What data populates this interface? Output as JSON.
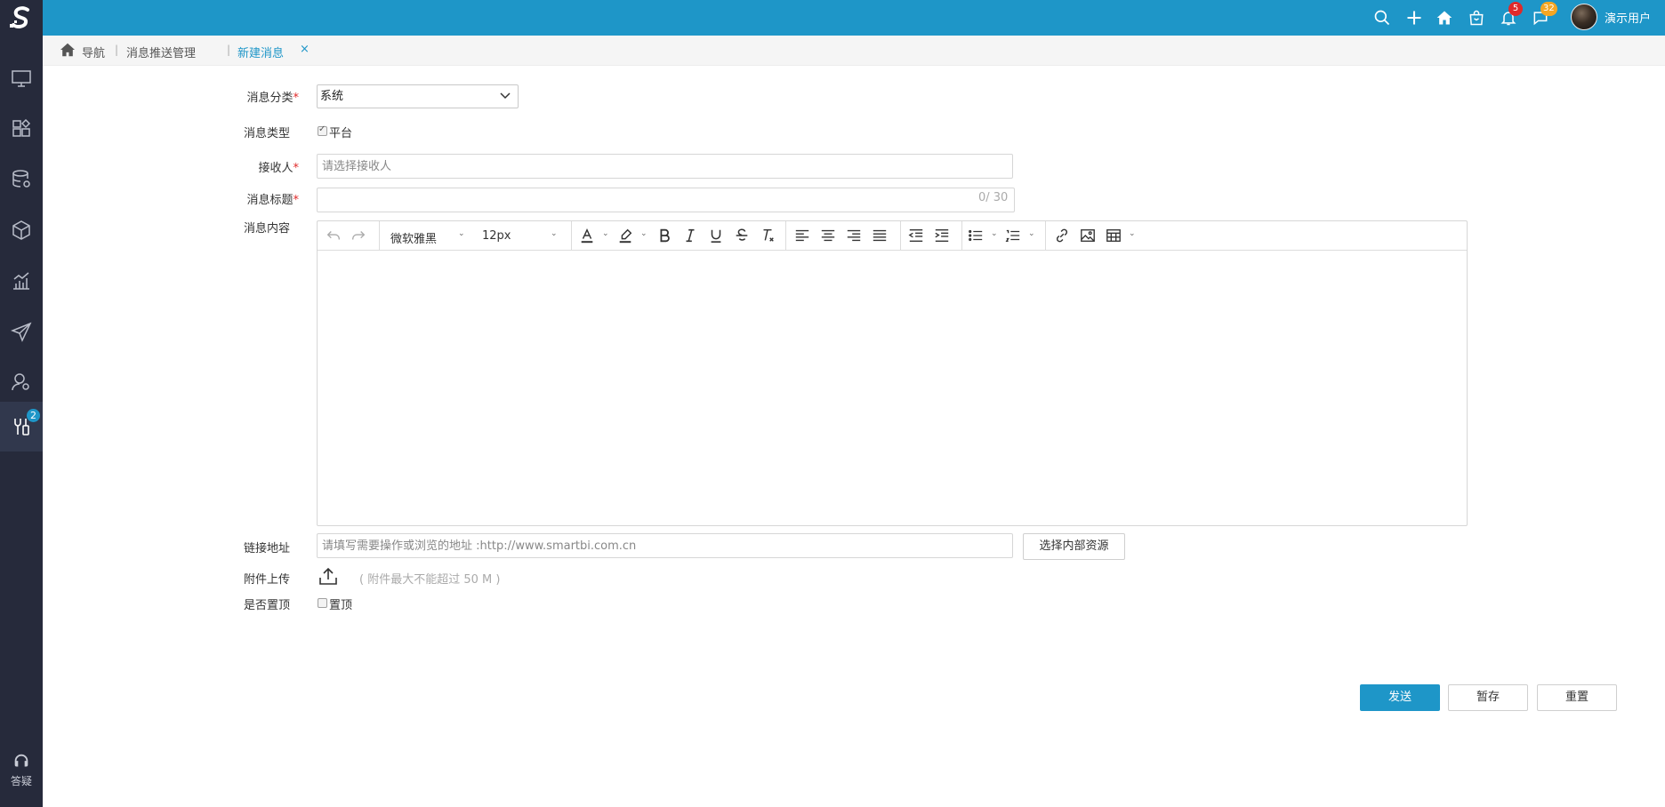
{
  "app": {
    "user_name": "演示用户"
  },
  "topbar": {
    "notifications_count": "5",
    "messages_count": "32"
  },
  "sidebar": {
    "badge": "2",
    "help_label": "答疑"
  },
  "breadcrumb": {
    "home": "导航",
    "parent": "消息推送管理",
    "current": "新建消息",
    "close": "×"
  },
  "form": {
    "category_label": "消息分类",
    "category_value": "系统",
    "type_label": "消息类型",
    "type_option": "平台",
    "recipient_label": "接收人",
    "recipient_placeholder": "请选择接收人",
    "title_label": "消息标题",
    "title_counter": "0/ 30",
    "content_label": "消息内容",
    "link_label": "链接地址",
    "link_placeholder": "请填写需要操作或浏览的地址 :http://www.smartbi.com.cn",
    "select_resource_button": "选择内部资源",
    "attachment_label": "附件上传",
    "attachment_hint": "( 附件最大不能超过 50 M )",
    "pin_label": "是否置顶",
    "pin_option": "置顶",
    "required_mark": "*"
  },
  "editor": {
    "font_family": "微软雅黑",
    "font_size": "12px"
  },
  "actions": {
    "send": "发送",
    "save_draft": "暂存",
    "reset": "重置"
  },
  "colors": {
    "primary": "#1e96c8",
    "sidebar": "#262a3b",
    "required": "#e02a2a"
  }
}
